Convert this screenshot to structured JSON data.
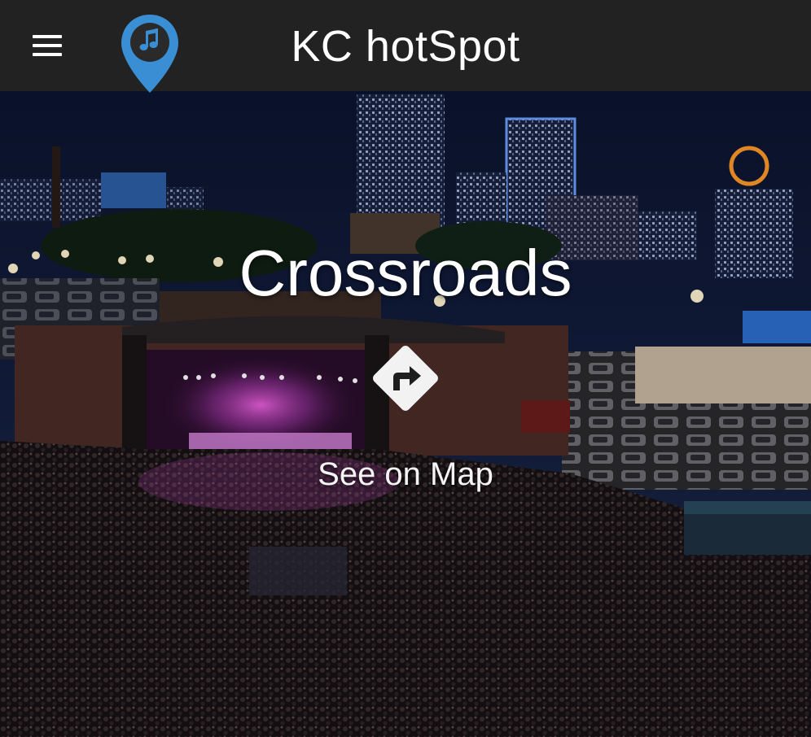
{
  "header": {
    "title": "KC hotSpot",
    "menu_icon": "hamburger-menu-icon",
    "logo_icon": "music-note-map-pin-icon"
  },
  "venue": {
    "name": "Crossroads",
    "map_link_label": "See on Map",
    "directions_icon": "turn-right-directions-icon"
  },
  "colors": {
    "header_background": "#222222",
    "logo_pin": "#3a8fd4",
    "text": "#ffffff"
  }
}
